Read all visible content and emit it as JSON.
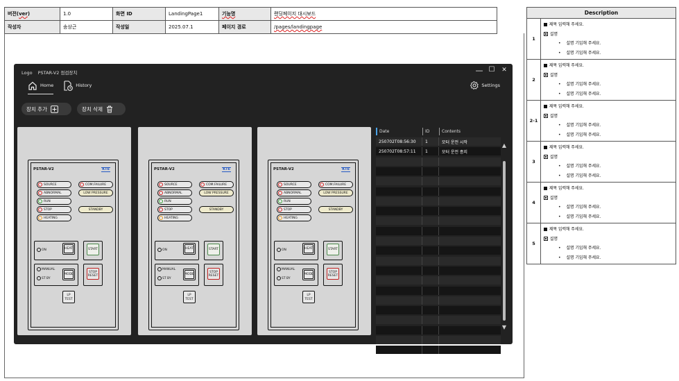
{
  "spec": {
    "version_label_pre": "버전(",
    "version_label_mid": "ver",
    "version_label_post": ")",
    "version": "1.0",
    "screen_id_label": "화면 ID",
    "screen_id": "LandingPage1",
    "function_label": "기능명",
    "function": "랜딩페이지 대시보드",
    "author_label": "작성자",
    "author": "송상근",
    "date_label": "작성일",
    "date": "2025.07.1",
    "path_label": "페이지 경로",
    "path": "/pages/landingpage"
  },
  "description": {
    "header": "Description",
    "title_text": "제목 입력해 주세요.",
    "desc_label": "설명",
    "bullet_text": "설명 기입해 주세요.",
    "rows": [
      {
        "num": "1"
      },
      {
        "num": "2"
      },
      {
        "num": "2-1"
      },
      {
        "num": "3"
      },
      {
        "num": "4"
      },
      {
        "num": "5"
      }
    ]
  },
  "app": {
    "logo": "Logo",
    "title": "PSTAR-V2 점검장치",
    "minimize": "—",
    "maximize": "☐",
    "close": "✕",
    "nav": {
      "home": "Home",
      "history": "History",
      "settings": "Settings"
    },
    "add_device": "장치 추가",
    "remove_device": "장치 삭제"
  },
  "device": {
    "model": "PSTAR-V2",
    "brand": "KTE",
    "source": "SOURCE",
    "abnormal": "ABNORMAL",
    "run": "RUN",
    "stop": "STOP",
    "heating": "HEATING",
    "com_failure": "COM.FAILURE",
    "low_pressure": "LOW PRESSURE",
    "standby": "STANDBY",
    "on": "ON",
    "heat": "HEAT",
    "start": "START",
    "manual": "MANUAL",
    "st_by": "ST BY",
    "mode": "MODE",
    "stop_reset_1": "STOP",
    "stop_reset_2": "RESET",
    "lp_1": "LP",
    "lp_2": "TEST"
  },
  "log": {
    "columns": [
      "Date",
      "ID",
      "Contents"
    ],
    "rows": [
      {
        "date": "250702T08:56:30",
        "id": "1",
        "content": "모터 운전 시작"
      },
      {
        "date": "250702T08:57:11",
        "id": "1",
        "content": "모터 운전 종지"
      }
    ],
    "empty_rows": 20
  }
}
